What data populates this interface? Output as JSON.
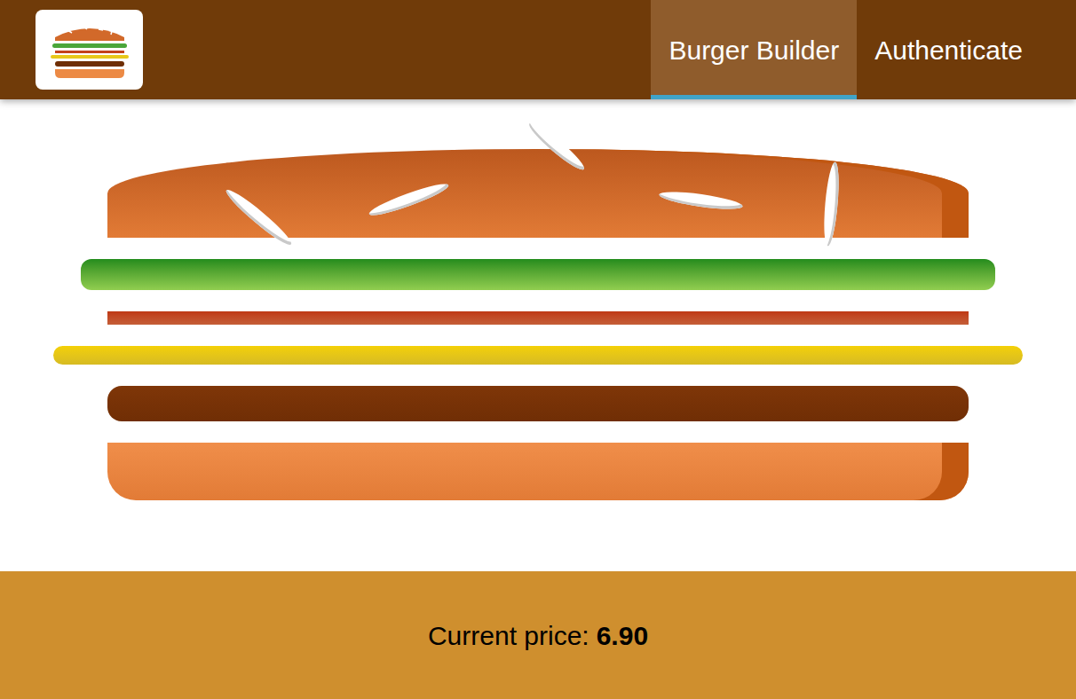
{
  "nav": [
    {
      "label": "Burger Builder",
      "selected": true
    },
    {
      "label": "Authenticate",
      "selected": false
    }
  ],
  "burger": {
    "ingredients": [
      {
        "kind": "bread-top"
      },
      {
        "kind": "salad"
      },
      {
        "kind": "bacon"
      },
      {
        "kind": "cheese"
      },
      {
        "kind": "meat"
      },
      {
        "kind": "bread-bottom"
      }
    ]
  },
  "controls": {
    "price_label": "Current price:",
    "price": "6.90"
  }
}
